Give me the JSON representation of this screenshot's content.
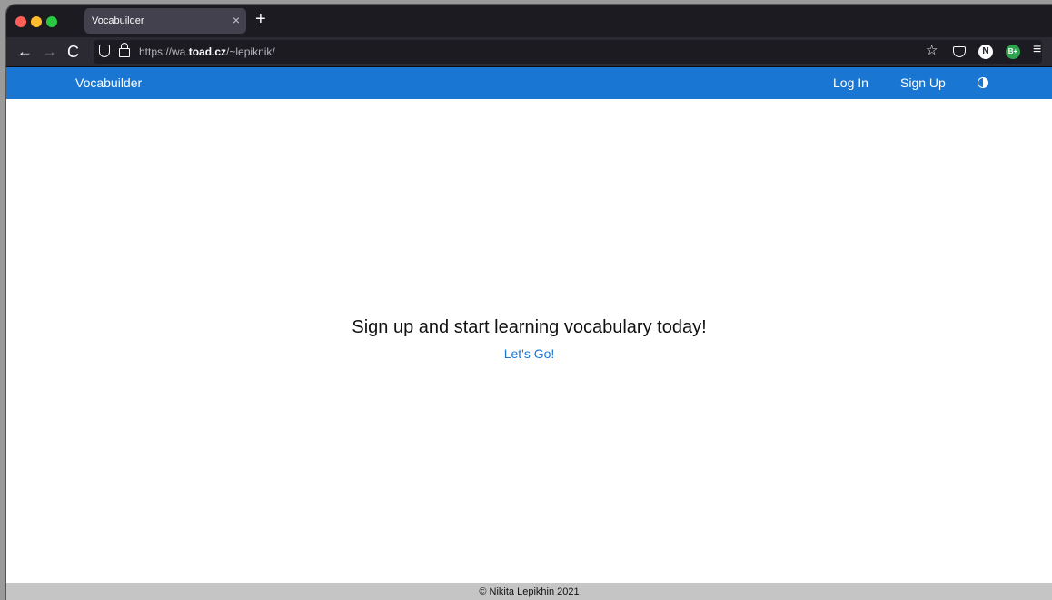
{
  "browser": {
    "tab_title": "Vocabuilder",
    "tab_close": "×",
    "new_tab": "+",
    "back": "←",
    "forward": "→",
    "reload": "C",
    "url_prefix": "https://wa.",
    "url_host": "toad.cz",
    "url_path": "/~lepiknik/",
    "star": "☆",
    "ext_n": "N",
    "ext_b": "B+",
    "menu": "≡"
  },
  "header": {
    "brand": "Vocabuilder",
    "login": "Log In",
    "signup": "Sign Up",
    "theme_icon": "contrast-icon"
  },
  "main": {
    "title": "Sign up and start learning vocabulary today!",
    "cta": "Let's Go!"
  },
  "footer": {
    "text": "© Nikita Lepikhin 2021"
  },
  "colors": {
    "accent": "#1976d2",
    "footer_bg": "#c5c5c5",
    "chrome_dark": "#1c1b22"
  }
}
